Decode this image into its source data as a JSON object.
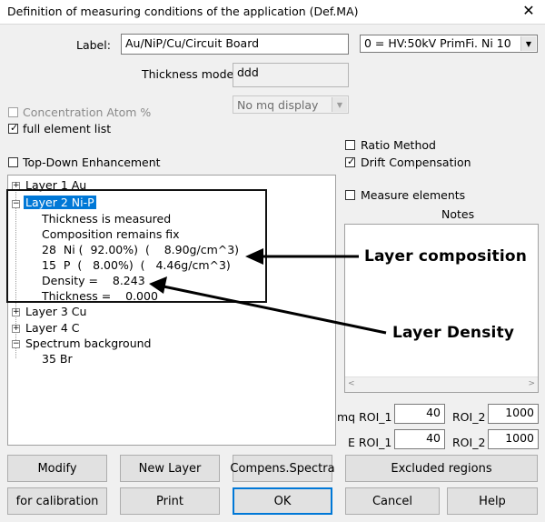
{
  "window": {
    "title": "Definition of measuring conditions of the application (Def.MA)",
    "close_glyph": "✕"
  },
  "form": {
    "label_caption": "Label:",
    "label_value": "Au/NiP/Cu/Circuit Board",
    "condition_value": "0 = HV:50kV PrimFi. Ni 10",
    "thickness_mode_caption": "Thickness mode",
    "thickness_mode_value": "ddd",
    "mq_display_value": "No mq display"
  },
  "checkboxes": {
    "concentration": {
      "label": "Concentration Atom %",
      "checked": false
    },
    "full_element_list": {
      "label": "full element list",
      "checked": true
    },
    "top_down": {
      "label": "Top-Down Enhancement",
      "checked": false
    },
    "ratio_method": {
      "label": "Ratio Method",
      "checked": false
    },
    "drift_compensation": {
      "label": "Drift Compensation",
      "checked": true
    },
    "measure_elements": {
      "label": "Measure elements",
      "checked": false
    }
  },
  "tree": {
    "layer1": "Layer 1  Au",
    "layer2": "Layer 2  Ni-P",
    "layer2_children": [
      "Thickness is measured",
      "Composition remains fix",
      "28  Ni (  92.00%)  (    8.90g/cm^3)",
      "15  P  (   8.00%)  (   4.46g/cm^3)",
      "Density =    8.243",
      "Thickness =    0.000"
    ],
    "layer3": "Layer 3  Cu",
    "layer4": "Layer 4  C",
    "spectrum": "Spectrum background",
    "spectrum_child": "35  Br"
  },
  "notes": {
    "caption": "Notes"
  },
  "roi": {
    "mq_label": "mq ROI_1",
    "mq_value": "40",
    "e_label": "E ROI_1",
    "e_value": "40",
    "roi2_label_1": "ROI_2",
    "roi2_value_1": "1000",
    "roi2_label_2": "ROI_2",
    "roi2_value_2": "1000"
  },
  "buttons": {
    "modify": "Modify",
    "new_layer": "New Layer",
    "compens": "Compens.Spectra",
    "excluded": "Excluded regions",
    "calibration": "for calibration",
    "print": "Print",
    "ok": "OK",
    "cancel": "Cancel",
    "help": "Help"
  },
  "annotations": {
    "layer_composition": "Layer composition",
    "layer_density": "Layer Density"
  },
  "colors": {
    "selection": "#0078d7",
    "annotation_arrow": "#000000"
  }
}
